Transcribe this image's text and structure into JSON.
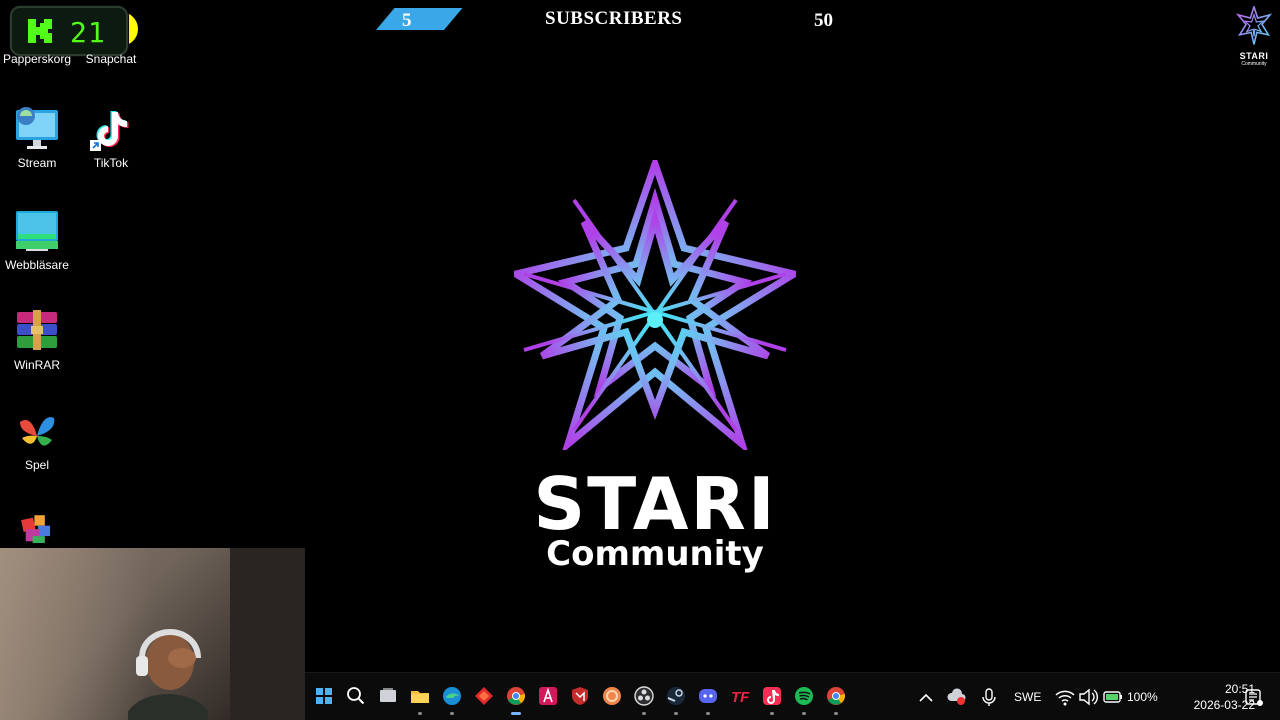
{
  "kick_widget": {
    "viewer_count": "21",
    "brand_color": "#53fc18"
  },
  "desktop": {
    "icons": [
      {
        "label": "Papperskorg",
        "icon": "recycle-bin-icon"
      },
      {
        "label": "Snapchat",
        "icon": "snapchat-icon"
      },
      {
        "label": "Stream",
        "icon": "stream-monitor-icon"
      },
      {
        "label": "TikTok",
        "icon": "tiktok-icon"
      },
      {
        "label": "Webbläsare",
        "icon": "browser-monitor-icon"
      },
      {
        "label": "WinRAR",
        "icon": "winrar-icon"
      },
      {
        "label": "Spel",
        "icon": "games-icon"
      },
      {
        "label": "",
        "icon": "app-icon"
      }
    ]
  },
  "subscriber_goal": {
    "current": "5",
    "title": "SUBSCRIBERS",
    "goal": "50",
    "progress_fraction": 0.1,
    "bar_color": "#3aa8e8"
  },
  "branding": {
    "title": "STARI",
    "subtitle": "Community",
    "corner_title": "STARI",
    "corner_subtitle": "Community",
    "gradient_colors": [
      "#b040e8",
      "#40e0f0"
    ]
  },
  "taskbar": {
    "apps": [
      {
        "name": "start-button",
        "icon": "windows-icon",
        "active": false,
        "running": false
      },
      {
        "name": "search-button",
        "icon": "search-icon",
        "active": false,
        "running": false
      },
      {
        "name": "task-view-button",
        "icon": "task-view-icon",
        "active": false,
        "running": false
      },
      {
        "name": "file-explorer",
        "icon": "folder-icon",
        "active": false,
        "running": true
      },
      {
        "name": "edge",
        "icon": "edge-icon",
        "active": false,
        "running": true
      },
      {
        "name": "app-red",
        "icon": "red-diamond-icon",
        "active": false,
        "running": false
      },
      {
        "name": "chrome-active",
        "icon": "chrome-icon",
        "active": true,
        "running": true
      },
      {
        "name": "adobe-app",
        "icon": "adobe-icon",
        "active": false,
        "running": false
      },
      {
        "name": "mcafee",
        "icon": "shield-icon",
        "active": false,
        "running": false
      },
      {
        "name": "orange-app",
        "icon": "orange-swirl-icon",
        "active": false,
        "running": false
      },
      {
        "name": "obs",
        "icon": "obs-icon",
        "active": false,
        "running": true
      },
      {
        "name": "steam",
        "icon": "steam-icon",
        "active": false,
        "running": true
      },
      {
        "name": "discord",
        "icon": "discord-icon",
        "active": false,
        "running": true
      },
      {
        "name": "tf-app",
        "icon": "tf-icon",
        "active": false,
        "running": false
      },
      {
        "name": "tiktok",
        "icon": "tiktok-icon",
        "active": false,
        "running": true
      },
      {
        "name": "spotify",
        "icon": "spotify-icon",
        "active": false,
        "running": true
      },
      {
        "name": "chrome-2",
        "icon": "chrome-icon",
        "active": false,
        "running": true
      }
    ],
    "tray": {
      "language": "SWE",
      "battery": "100%",
      "time": "20:51",
      "date": "2026-03-22"
    }
  }
}
